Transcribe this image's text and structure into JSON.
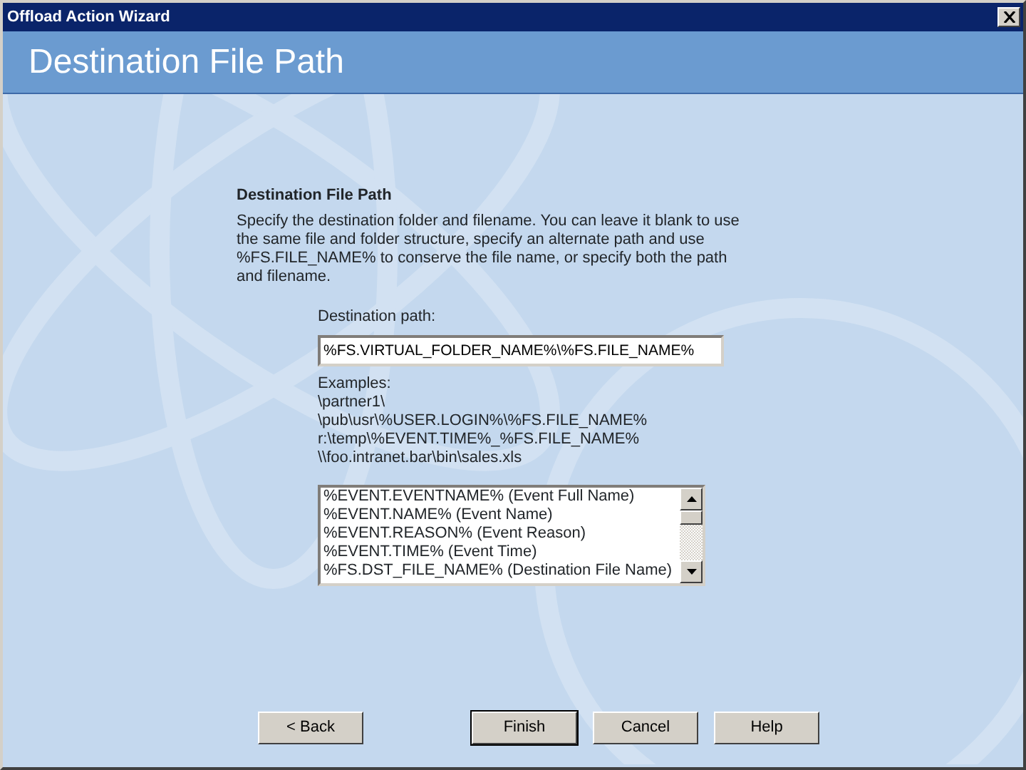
{
  "window": {
    "title": "Offload Action Wizard"
  },
  "header": {
    "title": "Destination File Path"
  },
  "section": {
    "heading": "Destination File Path",
    "description": "Specify the destination folder and filename. You can leave it blank to use the same file and folder structure, specify an alternate path and use %FS.FILE_NAME% to conserve the file name, or specify both the path and filename."
  },
  "destination_path": {
    "label": "Destination path:",
    "value": "%FS.VIRTUAL_FOLDER_NAME%\\%FS.FILE_NAME%"
  },
  "examples": [
    "Examples:",
    "\\partner1\\",
    "\\pub\\usr\\%USER.LOGIN%\\%FS.FILE_NAME%",
    "r:\\temp\\%EVENT.TIME%_%FS.FILE_NAME%",
    "\\\\foo.intranet.bar\\bin\\sales.xls"
  ],
  "variables_list": [
    "%EVENT.EVENTNAME% (Event Full Name)",
    "%EVENT.NAME% (Event Name)",
    "%EVENT.REASON% (Event Reason)",
    "%EVENT.TIME% (Event Time)",
    "%FS.DST_FILE_NAME% (Destination File Name)"
  ],
  "buttons": [
    {
      "label": "< Back",
      "default": false
    },
    {
      "label": "Finish",
      "default": true
    },
    {
      "label": "Cancel",
      "default": false
    },
    {
      "label": "Help",
      "default": false
    }
  ]
}
